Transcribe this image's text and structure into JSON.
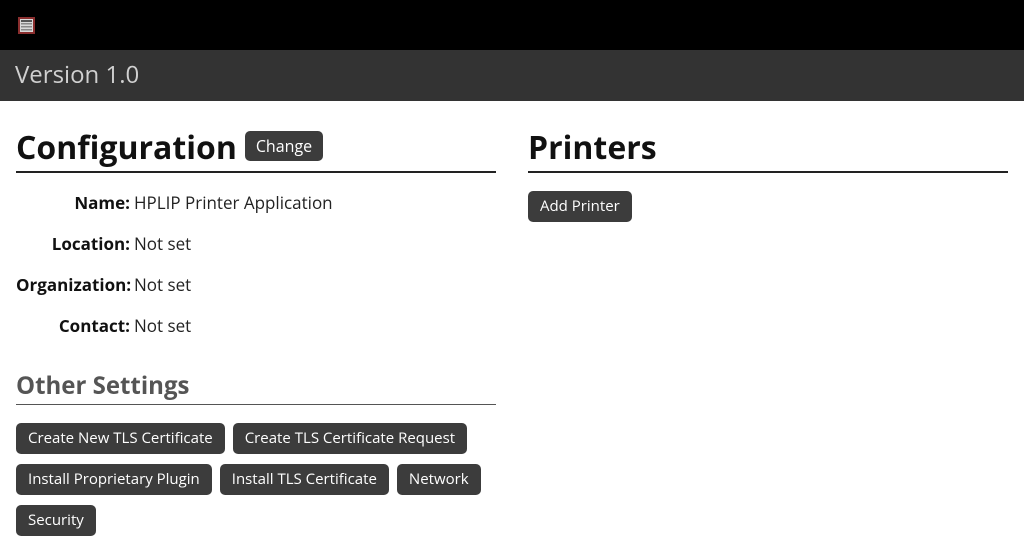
{
  "header": {
    "version": "Version 1.0"
  },
  "config": {
    "heading": "Configuration",
    "change_label": "Change",
    "fields": {
      "name_label": "Name:",
      "name_value": "HPLIP Printer Application",
      "location_label": "Location:",
      "location_value": "Not set",
      "organization_label": "Organization:",
      "organization_value": "Not set",
      "contact_label": "Contact:",
      "contact_value": "Not set"
    }
  },
  "other_settings": {
    "heading": "Other Settings",
    "buttons": {
      "create_tls_cert": "Create New TLS Certificate",
      "create_tls_request": "Create TLS Certificate Request",
      "install_plugin": "Install Proprietary Plugin",
      "install_tls_cert": "Install TLS Certificate",
      "network": "Network",
      "security": "Security"
    }
  },
  "printers": {
    "heading": "Printers",
    "add_label": "Add Printer"
  }
}
